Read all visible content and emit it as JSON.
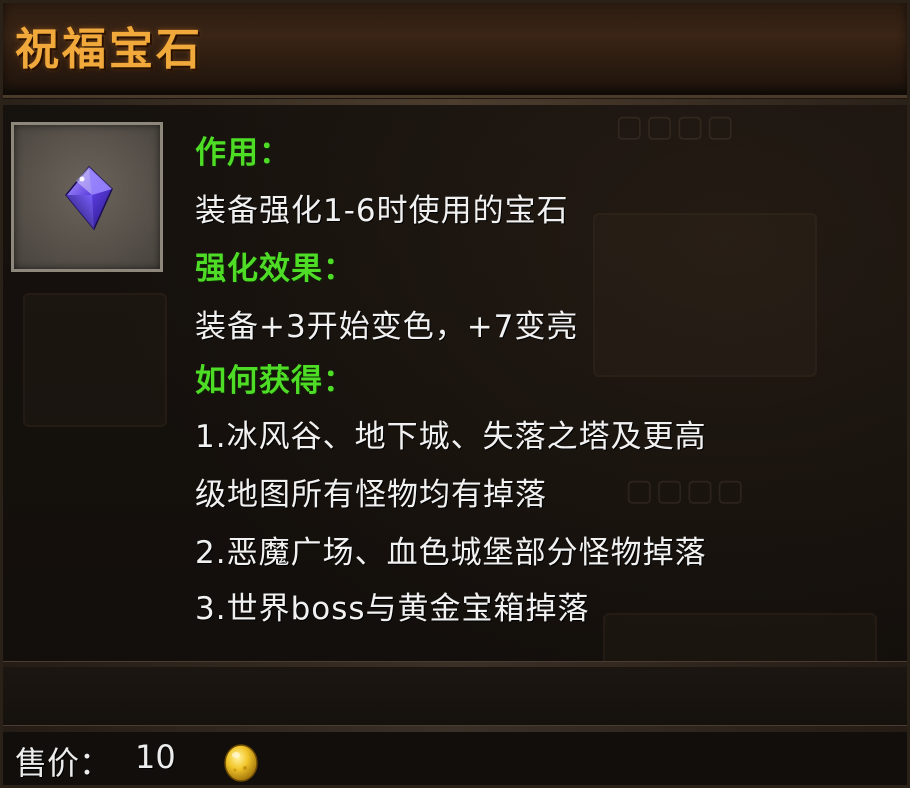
{
  "tooltip": {
    "title": "祝福宝石",
    "icon": "blue-gem-icon",
    "sections": [
      {
        "heading": "作用：",
        "lines": [
          "装备强化1-6时使用的宝石"
        ]
      },
      {
        "heading": "强化效果：",
        "lines": [
          "装备+3开始变色，+7变亮"
        ]
      },
      {
        "heading": "如何获得：",
        "lines": [
          "1.冰风谷、地下城、失落之塔及更高",
          "级地图所有怪物均有掉落",
          "2.恶魔广场、血色城堡部分怪物掉落",
          "3.世界boss与黄金宝箱掉落"
        ]
      }
    ],
    "price_label": "售价：",
    "price_value": "10",
    "currency_icon": "gold-coin-icon"
  },
  "colors": {
    "title": "#f0a93a",
    "heading": "#4fdc27",
    "body_text": "#f1f1f1",
    "background": "#14100c"
  }
}
